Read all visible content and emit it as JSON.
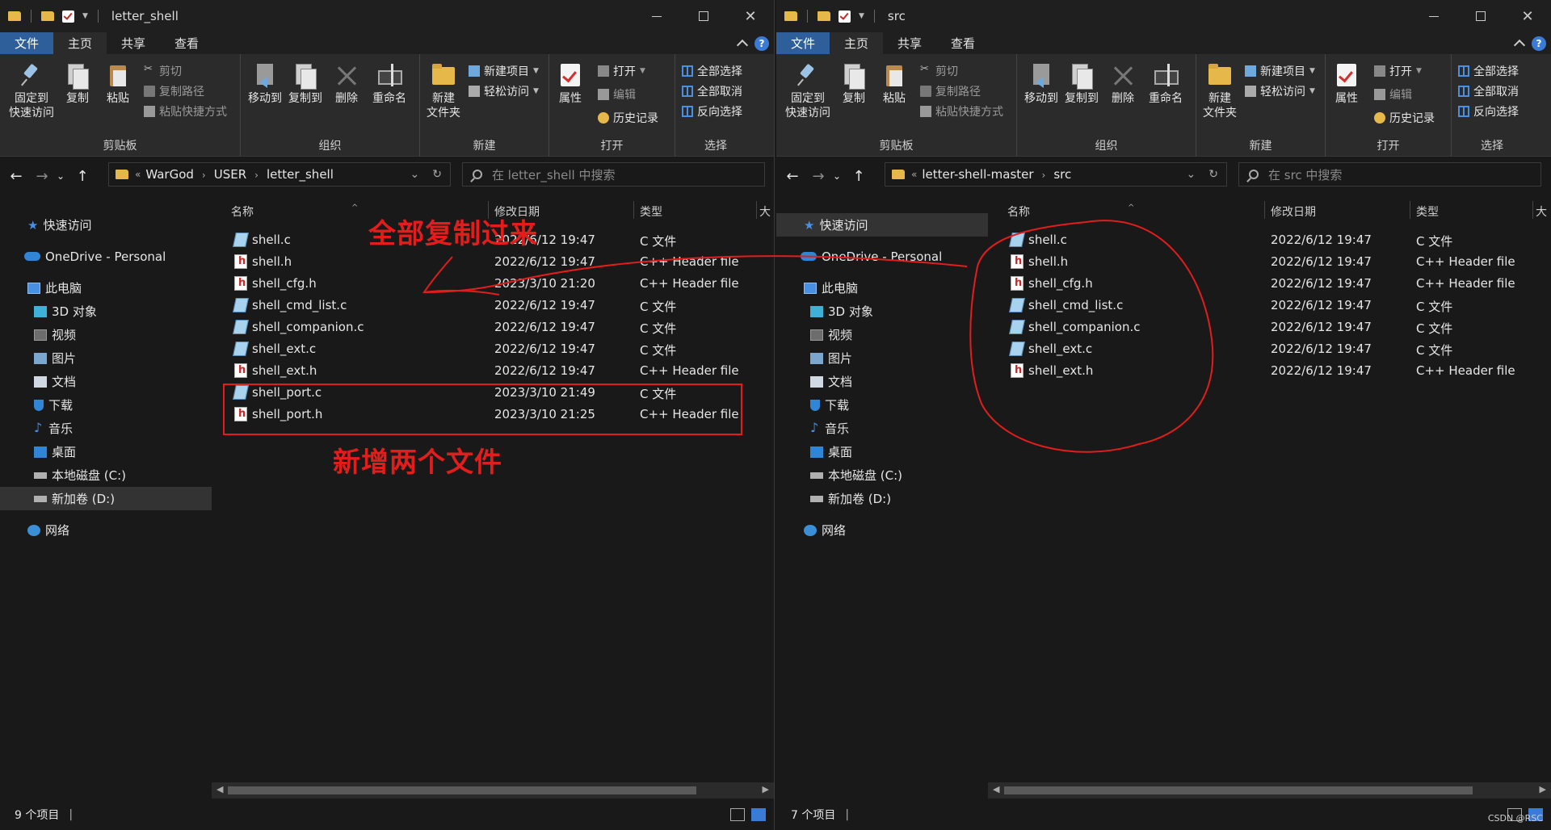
{
  "common": {
    "tabs": [
      "文件",
      "主页",
      "共享",
      "查看"
    ],
    "help": "?",
    "ribbon": {
      "clipboard": {
        "pin": "固定到\n快速访问",
        "copy": "复制",
        "paste": "粘贴",
        "cut": "剪切",
        "copy_path": "复制路径",
        "paste_shortcut": "粘贴快捷方式",
        "label": "剪贴板"
      },
      "organize": {
        "move_to": "移动到",
        "copy_to": "复制到",
        "delete": "删除",
        "rename": "重命名",
        "label": "组织"
      },
      "new": {
        "new_folder": "新建\n文件夹",
        "new_item": "新建项目",
        "easy_access": "轻松访问",
        "label": "新建"
      },
      "open": {
        "properties": "属性",
        "open": "打开",
        "edit": "编辑",
        "history": "历史记录",
        "label": "打开"
      },
      "select": {
        "select_all": "全部选择",
        "select_none": "全部取消",
        "invert": "反向选择",
        "label": "选择"
      }
    },
    "sidebar": {
      "quick_access": "快速访问",
      "onedrive": "OneDrive - Personal",
      "this_pc": "此电脑",
      "items": [
        "3D 对象",
        "视频",
        "图片",
        "文档",
        "下载",
        "音乐",
        "桌面",
        "本地磁盘 (C:)",
        "新加卷 (D:)"
      ],
      "network": "网络"
    },
    "columns": {
      "name": "名称",
      "date": "修改日期",
      "type": "类型",
      "size": "大"
    }
  },
  "left": {
    "title": "letter_shell",
    "breadcrumb": [
      "WarGod",
      "USER",
      "letter_shell"
    ],
    "search_placeholder": "在 letter_shell 中搜索",
    "files": [
      {
        "name": "shell.c",
        "date": "2022/6/12 19:47",
        "type": "C 文件",
        "kind": "c"
      },
      {
        "name": "shell.h",
        "date": "2022/6/12 19:47",
        "type": "C++ Header file",
        "kind": "h"
      },
      {
        "name": "shell_cfg.h",
        "date": "2023/3/10 21:20",
        "type": "C++ Header file",
        "kind": "h"
      },
      {
        "name": "shell_cmd_list.c",
        "date": "2022/6/12 19:47",
        "type": "C 文件",
        "kind": "c"
      },
      {
        "name": "shell_companion.c",
        "date": "2022/6/12 19:47",
        "type": "C 文件",
        "kind": "c"
      },
      {
        "name": "shell_ext.c",
        "date": "2022/6/12 19:47",
        "type": "C 文件",
        "kind": "c"
      },
      {
        "name": "shell_ext.h",
        "date": "2022/6/12 19:47",
        "type": "C++ Header file",
        "kind": "h"
      },
      {
        "name": "shell_port.c",
        "date": "2023/3/10 21:49",
        "type": "C 文件",
        "kind": "c"
      },
      {
        "name": "shell_port.h",
        "date": "2023/3/10 21:25",
        "type": "C++ Header file",
        "kind": "h"
      }
    ],
    "status": "9 个项目",
    "annot_copy_all": "全部复制过来",
    "annot_new_two": "新增两个文件"
  },
  "right": {
    "title": "src",
    "breadcrumb": [
      "letter-shell-master",
      "src"
    ],
    "search_placeholder": "在 src 中搜索",
    "files": [
      {
        "name": "shell.c",
        "date": "2022/6/12 19:47",
        "type": "C 文件",
        "kind": "c"
      },
      {
        "name": "shell.h",
        "date": "2022/6/12 19:47",
        "type": "C++ Header file",
        "kind": "h"
      },
      {
        "name": "shell_cfg.h",
        "date": "2022/6/12 19:47",
        "type": "C++ Header file",
        "kind": "h"
      },
      {
        "name": "shell_cmd_list.c",
        "date": "2022/6/12 19:47",
        "type": "C 文件",
        "kind": "c"
      },
      {
        "name": "shell_companion.c",
        "date": "2022/6/12 19:47",
        "type": "C 文件",
        "kind": "c"
      },
      {
        "name": "shell_ext.c",
        "date": "2022/6/12 19:47",
        "type": "C 文件",
        "kind": "c"
      },
      {
        "name": "shell_ext.h",
        "date": "2022/6/12 19:47",
        "type": "C++ Header file",
        "kind": "h"
      }
    ],
    "status": "7 个项目"
  },
  "watermark": "CSDN @RSC"
}
